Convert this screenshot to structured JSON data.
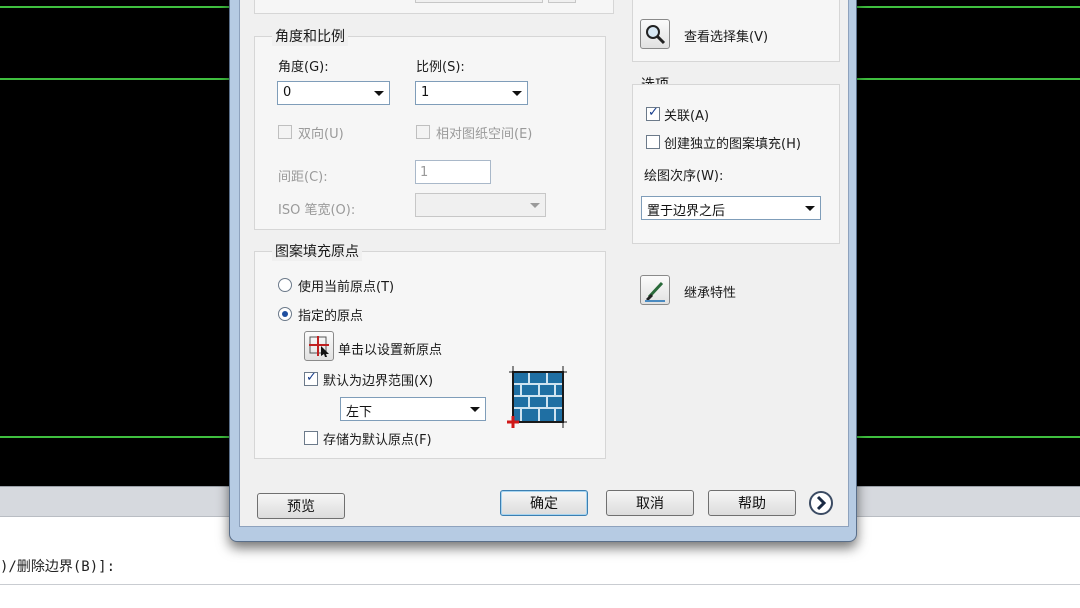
{
  "angle_scale": {
    "group_title": "角度和比例",
    "angle_label": "角度(G):",
    "angle_value": "0",
    "scale_label": "比例(S):",
    "scale_value": "1",
    "double_label": "双向(U)",
    "relative_label": "相对图纸空间(E)",
    "spacing_label": "间距(C):",
    "spacing_value": "1",
    "iso_label": "ISO 笔宽(O):"
  },
  "origin": {
    "group_title": "图案填充原点",
    "use_current_label": "使用当前原点(T)",
    "specified_label": "指定的原点",
    "click_set_label": "单击以设置新原点",
    "default_boundary_label": "默认为边界范围(X)",
    "boundary_value": "左下",
    "store_default_label": "存储为默认原点(F)"
  },
  "right_panel": {
    "view_selection_label": "查看选择集(V)",
    "options_title": "选项",
    "associative_label": "关联(A)",
    "independent_label": "创建独立的图案填充(H)",
    "draw_order_label": "绘图次序(W):",
    "draw_order_value": "置于边界之后",
    "inherit_label": "继承特性"
  },
  "buttons": {
    "preview": "预览",
    "ok": "确定",
    "cancel": "取消",
    "help": "帮助"
  },
  "command_line": {
    "text": ")/删除边界(B)]:"
  },
  "colors": {
    "cad_background": "#000000",
    "grid_line": "#3fbf3f",
    "dialog_frame": "#b6cbe3"
  }
}
